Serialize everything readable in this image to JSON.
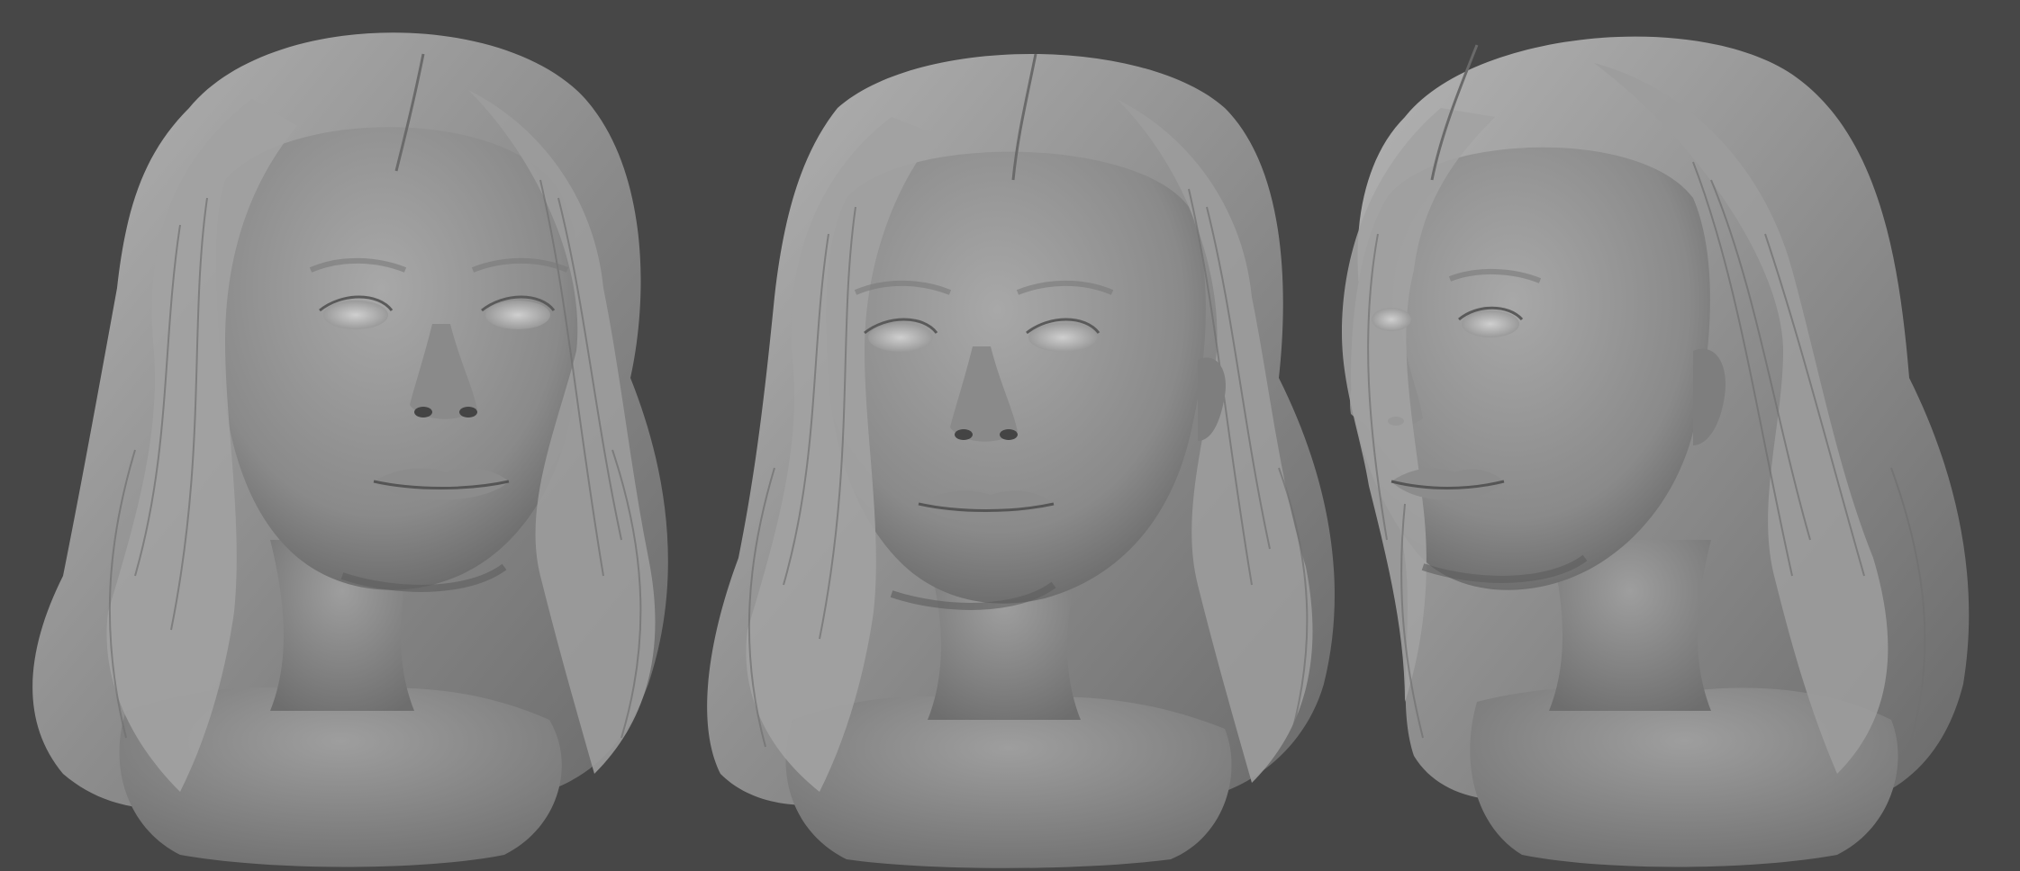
{
  "scene": {
    "background_color": "#474747",
    "clay_color": "#9a9a9a",
    "clay_highlight": "#bdbdbd",
    "clay_shadow": "#5a5a5a",
    "views": [
      {
        "id": "front",
        "label": "",
        "orientation": "front"
      },
      {
        "id": "three-quarter",
        "label": "",
        "orientation": "three-quarter"
      },
      {
        "id": "profile-right",
        "label": "",
        "orientation": "three-quarter-right"
      }
    ]
  }
}
